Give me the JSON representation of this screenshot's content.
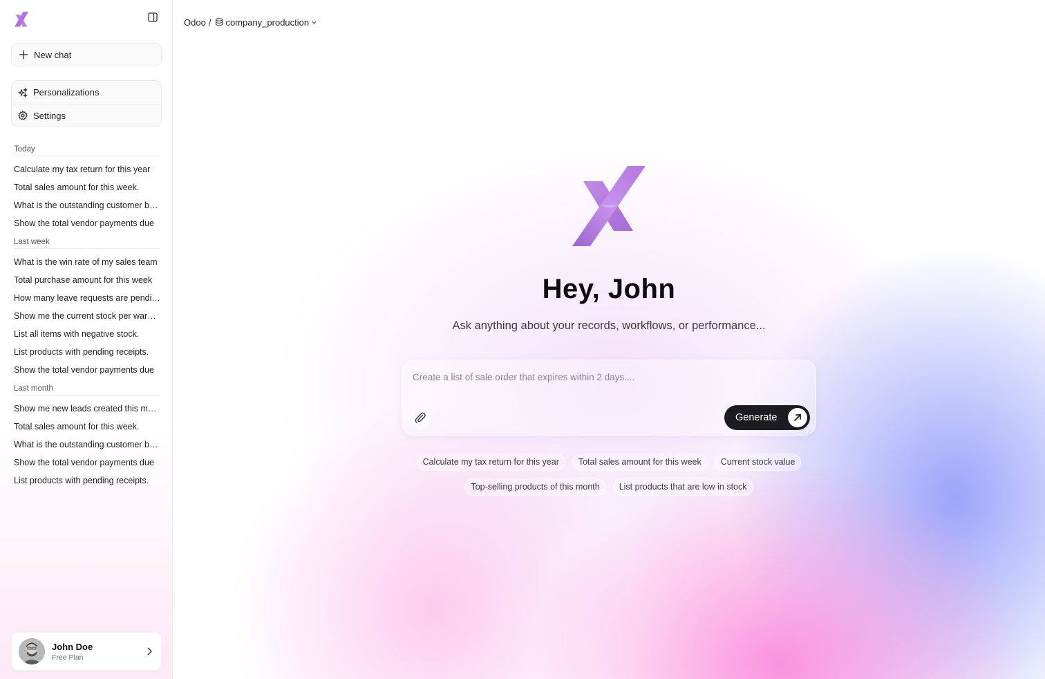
{
  "sidebar": {
    "new_chat": "New chat",
    "menu": {
      "personalizations": "Personalizations",
      "settings": "Settings"
    },
    "sections": [
      {
        "title": "Today",
        "items": [
          "Calculate my tax return for this year",
          "Total sales amount for this week.",
          "What is the outstanding customer balance",
          "Show the total vendor payments due"
        ]
      },
      {
        "title": "Last week",
        "items": [
          "What is the win rate of my sales team",
          "Total purchase amount for this week",
          "How many leave requests are pending",
          "Show me the current stock per  warehouse",
          "List all items with negative stock.",
          "List products with pending receipts.",
          "Show the total vendor payments due"
        ]
      },
      {
        "title": "Last month",
        "items": [
          "Show me new leads created this month",
          "Total sales amount for this week.",
          "What is the outstanding customer balance",
          "Show the total vendor payments due",
          "List products with pending receipts."
        ]
      }
    ],
    "user": {
      "name": "John Doe",
      "plan": "Free Plan"
    }
  },
  "header": {
    "breadcrumb_root": "Odoo",
    "separator": "/",
    "database": "company_production"
  },
  "hero": {
    "greeting": "Hey, John",
    "subtitle": "Ask anything about your records, workflows, or performance..."
  },
  "prompt": {
    "placeholder": "Create a list of sale order that expires within 2 days....",
    "generate_label": "Generate"
  },
  "suggestions": {
    "row1": [
      "Calculate my tax return for this year",
      "Total sales amount for this week",
      "Current stock value"
    ],
    "row2": [
      "Top-selling products of this month",
      "List products that are low in stock"
    ]
  },
  "colors": {
    "brand_purple": "#a86bd9",
    "generate_button": "#1c1c20"
  }
}
